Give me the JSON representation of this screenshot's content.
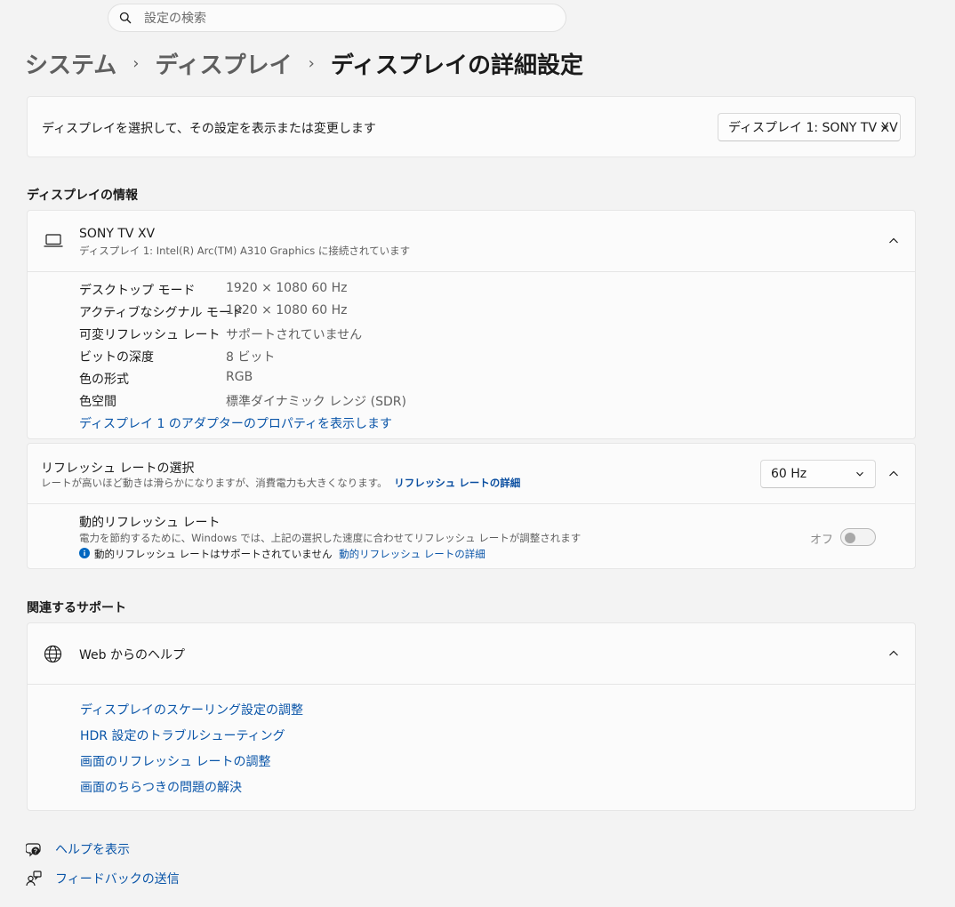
{
  "search": {
    "placeholder": "設定の検索",
    "icon": "search-icon"
  },
  "breadcrumb": {
    "items": [
      "システム",
      "ディスプレイ",
      "ディスプレイの詳細設定"
    ],
    "separator": "›"
  },
  "display_select": {
    "label": "ディスプレイを選択して、その設定を表示または変更します",
    "value": "ディスプレイ 1: SONY TV XV"
  },
  "display_info": {
    "heading": "ディスプレイの情報",
    "name": "SONY TV XV",
    "subtitle": "ディスプレイ 1: Intel(R) Arc(TM) A310 Graphics に接続されています",
    "rows": [
      {
        "key": "デスクトップ モード",
        "value": "1920 × 1080 60 Hz"
      },
      {
        "key": "アクティブなシグナル モード",
        "value": "1920 × 1080 60 Hz"
      },
      {
        "key": "可変リフレッシュ レート",
        "value": "サポートされていません"
      },
      {
        "key": "ビットの深度",
        "value": "8 ビット"
      },
      {
        "key": "色の形式",
        "value": "RGB"
      },
      {
        "key": "色空間",
        "value": "標準ダイナミック レンジ (SDR)"
      }
    ],
    "adapter_link": "ディスプレイ 1 のアダプターのプロパティを表示します"
  },
  "refresh": {
    "title": "リフレッシュ レートの選択",
    "desc": "レートが高いほど動きは滑らかになりますが、消費電力も大きくなります。",
    "desc_link": "リフレッシュ レートの詳細",
    "value": "60 Hz"
  },
  "dynamic_refresh": {
    "title": "動的リフレッシュ レート",
    "desc": "電力を節約するために、Windows では、上記の選択した速度に合わせてリフレッシュ レートが調整されます",
    "note": "動的リフレッシュ レートはサポートされていません",
    "note_link": "動的リフレッシュ レートの詳細",
    "toggle_label": "オフ",
    "toggle_on": false
  },
  "support": {
    "heading": "関連するサポート",
    "title": "Web からのヘルプ",
    "links": [
      "ディスプレイのスケーリング設定の調整",
      "HDR 設定のトラブルシューティング",
      "画面のリフレッシュ レートの調整",
      "画面のちらつきの問題の解決"
    ]
  },
  "footer": {
    "help": "ヘルプを表示",
    "feedback": "フィードバックの送信"
  },
  "colors": {
    "background": "#f3f3f3",
    "card": "#fbfbfb",
    "link": "#0a55a8",
    "info_accent": "#0067c0"
  }
}
